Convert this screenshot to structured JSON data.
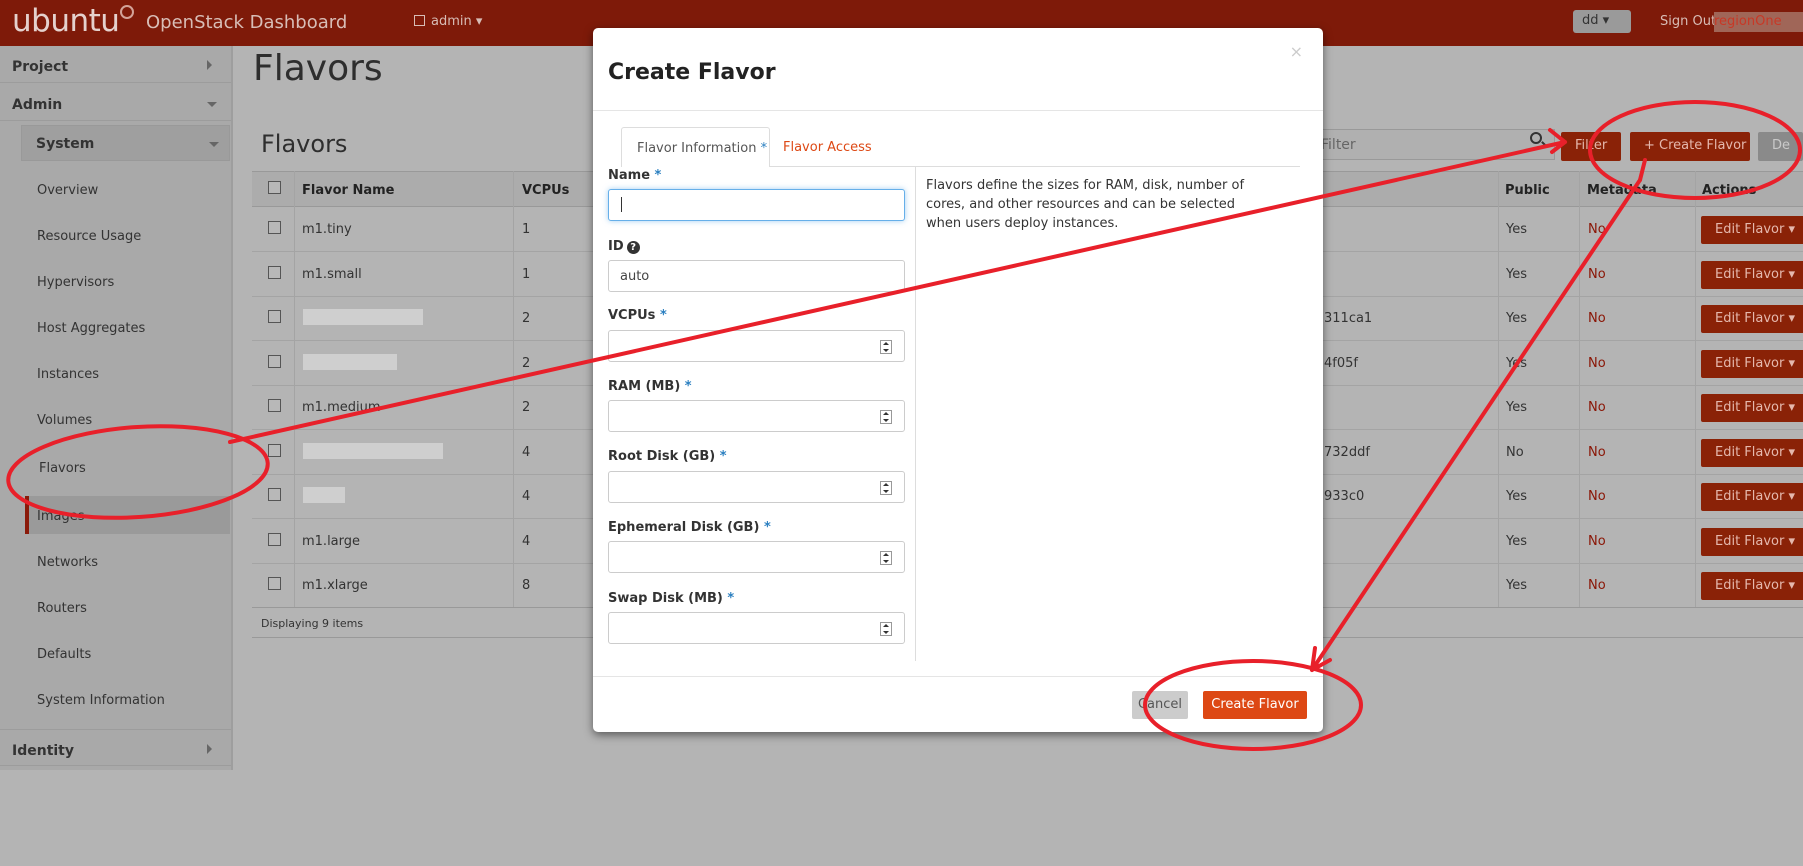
{
  "header": {
    "logo": "ubuntu",
    "brand": "OpenStack Dashboard",
    "project": "admin",
    "user": "dd",
    "sign_out": "Sign Out",
    "region": "regionOne",
    "accent": "#7e1a09"
  },
  "sidebar": {
    "sections": [
      "Project",
      "Admin",
      "Identity"
    ],
    "panel_group": "System",
    "items": [
      "Overview",
      "Resource Usage",
      "Hypervisors",
      "Host Aggregates",
      "Instances",
      "Volumes",
      "Flavors",
      "Images",
      "Networks",
      "Routers",
      "Defaults",
      "System Information"
    ],
    "active": "Flavors"
  },
  "main": {
    "page_title": "Flavors",
    "table_title": "Flavors",
    "filter_placeholder": "Filter",
    "filter_button": "Filter",
    "create_button": "+ Create Flavor",
    "delete_button": "De",
    "columns": [
      "Flavor Name",
      "VCPUs",
      "Public",
      "Metadata",
      "Actions"
    ],
    "rows": [
      {
        "name": "m1.tiny",
        "vcpus": "1",
        "id_frag": "",
        "public": "Yes",
        "metadata": "No",
        "action": "Edit Flavor"
      },
      {
        "name": "m1.small",
        "vcpus": "1",
        "id_frag": "",
        "public": "Yes",
        "metadata": "No",
        "action": "Edit Flavor"
      },
      {
        "name": "",
        "vcpus": "2",
        "id_frag": "311ca1",
        "public": "Yes",
        "metadata": "No",
        "action": "Edit Flavor"
      },
      {
        "name": "",
        "vcpus": "2",
        "id_frag": "4f05f",
        "public": "Yes",
        "metadata": "No",
        "action": "Edit Flavor"
      },
      {
        "name": "m1.medium",
        "vcpus": "2",
        "id_frag": "",
        "public": "Yes",
        "metadata": "No",
        "action": "Edit Flavor"
      },
      {
        "name": "",
        "vcpus": "4",
        "id_frag": "732ddf",
        "public": "No",
        "metadata": "No",
        "action": "Edit Flavor"
      },
      {
        "name": "",
        "vcpus": "4",
        "id_frag": "933c0",
        "public": "Yes",
        "metadata": "No",
        "action": "Edit Flavor"
      },
      {
        "name": "m1.large",
        "vcpus": "4",
        "id_frag": "",
        "public": "Yes",
        "metadata": "No",
        "action": "Edit Flavor"
      },
      {
        "name": "m1.xlarge",
        "vcpus": "8",
        "id_frag": "",
        "public": "Yes",
        "metadata": "No",
        "action": "Edit Flavor"
      }
    ],
    "footer": "Displaying 9 items"
  },
  "modal": {
    "title": "Create Flavor",
    "close": "×",
    "tabs": [
      "Flavor Information",
      "Flavor Access"
    ],
    "required_mark": "*",
    "fields": [
      {
        "label": "Name",
        "value": ""
      },
      {
        "label": "ID",
        "value": "auto"
      },
      {
        "label": "VCPUs",
        "value": ""
      },
      {
        "label": "RAM (MB)",
        "value": ""
      },
      {
        "label": "Root Disk (GB)",
        "value": ""
      },
      {
        "label": "Ephemeral Disk (GB)",
        "value": ""
      },
      {
        "label": "Swap Disk (MB)",
        "value": ""
      }
    ],
    "help": "Flavors define the sizes for RAM, disk, number of cores, and other resources and can be selected when users deploy instances.",
    "cancel": "Cancel",
    "submit": "Create Flavor"
  },
  "annotation_color": "#e8202a"
}
